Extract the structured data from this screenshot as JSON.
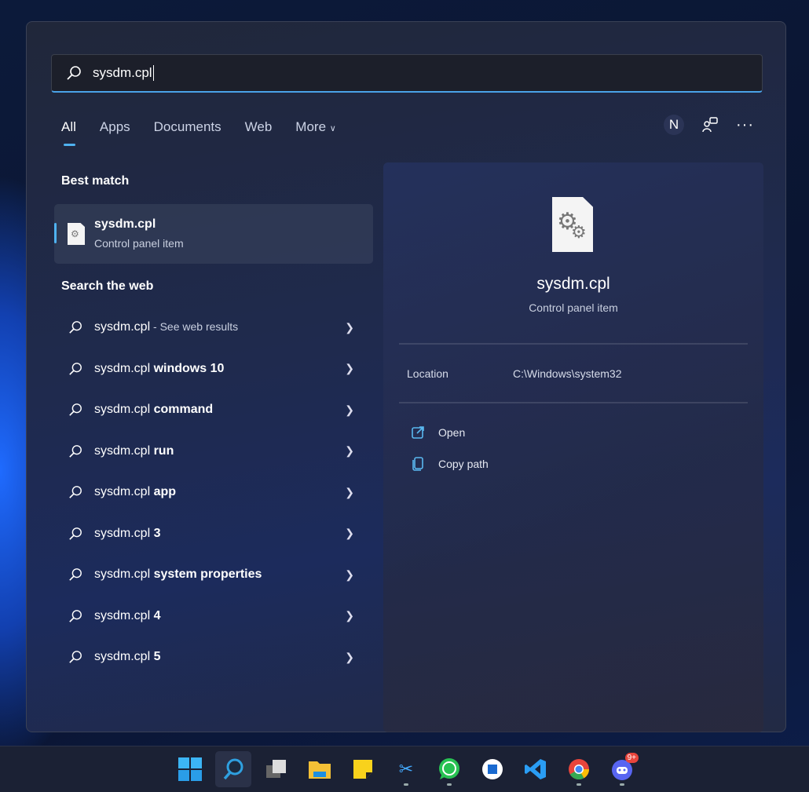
{
  "search": {
    "value": "sysdm.cpl"
  },
  "tabs": [
    {
      "label": "All",
      "active": true
    },
    {
      "label": "Apps"
    },
    {
      "label": "Documents"
    },
    {
      "label": "Web"
    },
    {
      "label": "More"
    }
  ],
  "header_icons": {
    "avatar_letter": "N",
    "icons": [
      "feedback-icon",
      "more-icon"
    ]
  },
  "best_match": {
    "heading": "Best match",
    "title": "sysdm.cpl",
    "subtitle": "Control panel item"
  },
  "web": {
    "heading": "Search the web",
    "items": [
      {
        "prefix": "sysdm.cpl",
        "suffix": "",
        "sub": " - See web results"
      },
      {
        "prefix": "sysdm.cpl",
        "suffix": " windows 10"
      },
      {
        "prefix": "sysdm.cpl",
        "suffix": " command"
      },
      {
        "prefix": "sysdm.cpl",
        "suffix": " run"
      },
      {
        "prefix": "sysdm.cpl",
        "suffix": " app"
      },
      {
        "prefix": "sysdm.cpl",
        "suffix": " 3"
      },
      {
        "prefix": "sysdm.cpl",
        "suffix": " system properties"
      },
      {
        "prefix": "sysdm.cpl",
        "suffix": " 4"
      },
      {
        "prefix": "sysdm.cpl",
        "suffix": " 5"
      }
    ]
  },
  "detail": {
    "title": "sysdm.cpl",
    "subtitle": "Control panel item",
    "location_label": "Location",
    "location_value": "C:\\Windows\\system32",
    "actions": [
      {
        "label": "Open",
        "icon": "open-external-icon"
      },
      {
        "label": "Copy path",
        "icon": "copy-icon"
      }
    ]
  },
  "taskbar": {
    "apps": [
      "start",
      "search",
      "task-view",
      "file-explorer",
      "sticky-notes",
      "snipping-tool",
      "whatsapp",
      "word-app",
      "vscode",
      "chrome",
      "discord"
    ],
    "discord_badge": "9+"
  },
  "colors": {
    "accent": "#4fb2f0"
  }
}
